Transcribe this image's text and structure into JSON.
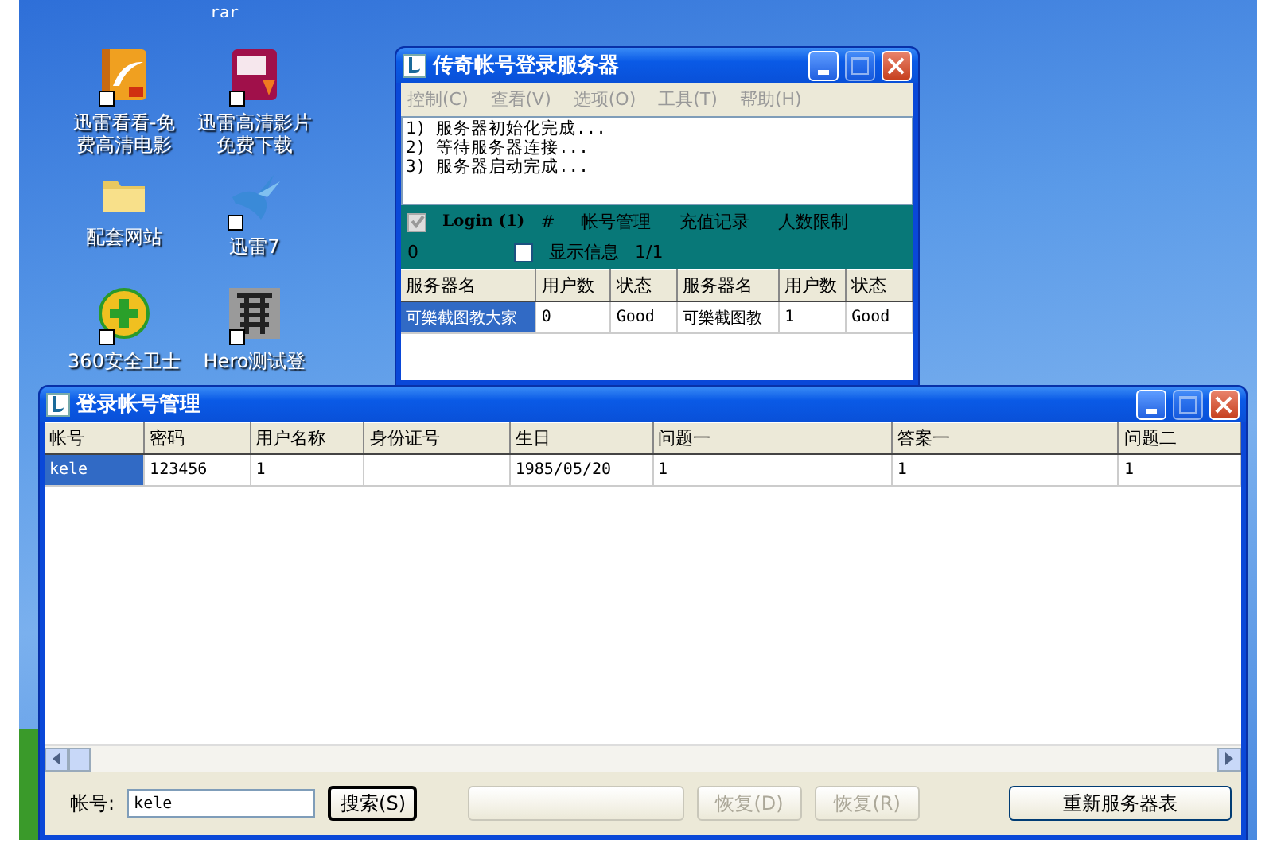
{
  "desktop": {
    "top_label": "rar",
    "icons": [
      {
        "label": "迅雷看看-免费高清电影",
        "kind": "film"
      },
      {
        "label": "迅雷高清影片免费下载",
        "kind": "hd"
      },
      {
        "label": "配套网站",
        "kind": "folder"
      },
      {
        "label": "迅雷7",
        "kind": "bird"
      },
      {
        "label": "360安全卫士",
        "kind": "plus"
      },
      {
        "label": "Hero测试登",
        "kind": "tile"
      }
    ]
  },
  "server_window": {
    "title": "传奇帐号登录服务器",
    "menu": [
      "控制(C)",
      "查看(V)",
      "选项(O)",
      "工具(T)",
      "帮助(H)"
    ],
    "log": [
      "1) 服务器初始化完成...",
      "2) 等待服务器连接...",
      "3) 服务器启动完成..."
    ],
    "login_check": {
      "label": "Login (1)",
      "checked": true,
      "disabled": true
    },
    "hash": "#",
    "tabs": [
      "帐号管理",
      "充值记录",
      "人数限制"
    ],
    "count": "0",
    "show_info": {
      "label": "显示信息",
      "checked": false
    },
    "page": "1/1",
    "table": {
      "columns": [
        "服务器名",
        "用户数",
        "状态",
        "服务器名",
        "用户数",
        "状态"
      ],
      "rows": [
        {
          "selected": true,
          "cells": [
            "可樂截图教大家",
            "0",
            "Good",
            "可樂截图教",
            "1",
            "Good"
          ]
        }
      ]
    }
  },
  "account_window": {
    "title": "登录帐号管理",
    "table": {
      "columns": [
        "帐号",
        "密码",
        "用户名称",
        "身份证号",
        "生日",
        "问题一",
        "答案一",
        "问题二"
      ],
      "rows": [
        {
          "selected": true,
          "cells": [
            "kele",
            "123456",
            "1",
            "",
            "1985/05/20",
            "1",
            "1",
            "1"
          ]
        }
      ]
    },
    "search": {
      "label": "帐号:",
      "value": "kele"
    },
    "buttons": [
      {
        "kind": "default",
        "label": "搜索(S)",
        "disabled": false
      },
      {
        "kind": "blank",
        "disabled": true
      },
      {
        "kind": "normal",
        "label": "恢复(D)",
        "disabled": true
      },
      {
        "kind": "normal",
        "label": "恢复(R)",
        "disabled": true
      },
      {
        "kind": "wide",
        "label": "重新服务器表",
        "disabled": false
      }
    ]
  }
}
